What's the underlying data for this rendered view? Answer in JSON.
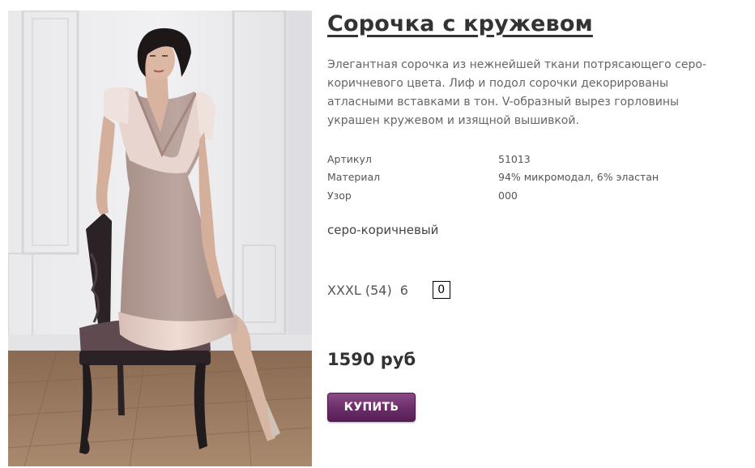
{
  "product": {
    "title": "Сорочка с кружевом",
    "description": "Элегантная сорочка из нежнейшей ткани потрясающего серо-коричневого цвета. Лиф и подол сорочки декорированы атласными вставками в тон. V-образный вырез горловины украшен кружевом и изящной вышивкой.",
    "image_icon": "product-photo",
    "specs": [
      {
        "label": "Артикул",
        "value": "51013"
      },
      {
        "label": "Материал",
        "value": "94% микромодал, 6% эластан"
      },
      {
        "label": "Узор",
        "value": "000"
      }
    ],
    "color_name": "серо-коричневый",
    "size": {
      "label": "XXXL (54)",
      "stock": "6",
      "quantity": "0"
    },
    "price": "1590 руб",
    "buy_label": "КУПИТЬ"
  },
  "colors": {
    "accent": "#6b2d69",
    "text": "#333333",
    "muted": "#666666"
  }
}
